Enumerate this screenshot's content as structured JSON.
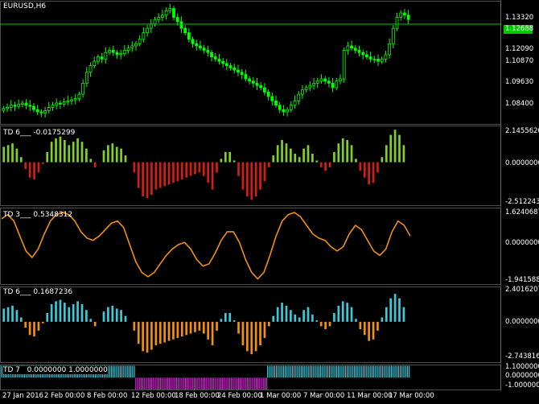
{
  "chart_title": "EURUSD,H6",
  "current_price": "1.12688",
  "colors": {
    "background": "#000000",
    "candle_up": "#00ff00",
    "candle_down": "#00ff00",
    "price_line": "#00c800",
    "td1_pos": "#7fd02a",
    "td1_neg": "#d11f14",
    "td2_line": "#f09010",
    "td3_pos": "#3cc8d8",
    "td3_neg": "#f09010",
    "td4_pos": "#3cc8d8",
    "td4_neg": "#e020e0",
    "separator": "#c0c0c0"
  },
  "main_pane": {
    "title": "EURUSD,H6",
    "y_ticks": [
      "1.13320",
      "1.12090",
      "1.10870",
      "1.09630",
      "1.08400"
    ]
  },
  "indicator_panes": [
    {
      "title": "TD 6___",
      "value": "-0.0175299",
      "y_ticks": [
        "2.1455620",
        "0.0000000",
        "-2.5122434"
      ]
    },
    {
      "title": "TD 3___",
      "value": "0.5348312",
      "y_ticks": [
        "1.6240687",
        "0.0000000",
        "-1.9415880"
      ]
    },
    {
      "title": "TD 6___",
      "value": "0.1687236",
      "y_ticks": [
        "2.4016207",
        "0.0000000",
        "-2.7438162"
      ]
    },
    {
      "title": "TD 7",
      "value": "0.0000000 1.0000000",
      "y_ticks": [
        "1.1000000",
        "0.0000000",
        "-1.0000000"
      ]
    }
  ],
  "x_ticks": [
    "27 Jan 2016",
    "2 Feb 00:00",
    "8 Feb 00:00",
    "12 Feb 00:00",
    "18 Feb 00:00",
    "24 Feb 00:00",
    "1 Mar 00:00",
    "7 Mar 00:00",
    "11 Mar 00:00",
    "17 Mar 00:00"
  ],
  "chart_data": [
    {
      "type": "candlestick",
      "title": "EURUSD,H6",
      "ylim": [
        1.0815,
        1.1375
      ],
      "close_series": [
        1.0885,
        1.089,
        1.09,
        1.0895,
        1.0905,
        1.091,
        1.09,
        1.0895,
        1.088,
        1.087,
        1.0865,
        1.0875,
        1.089,
        1.09,
        1.091,
        1.0905,
        1.0915,
        1.092,
        1.0925,
        1.093,
        1.095,
        1.1,
        1.105,
        1.108,
        1.11,
        1.112,
        1.111,
        1.114,
        1.115,
        1.114,
        1.113,
        1.1135,
        1.115,
        1.116,
        1.117,
        1.118,
        1.12,
        1.123,
        1.125,
        1.127,
        1.129,
        1.13,
        1.131,
        1.133,
        1.134,
        1.13,
        1.128,
        1.125,
        1.123,
        1.12,
        1.118,
        1.117,
        1.116,
        1.115,
        1.114,
        1.112,
        1.111,
        1.11,
        1.109,
        1.108,
        1.107,
        1.106,
        1.105,
        1.104,
        1.102,
        1.101,
        1.1,
        1.099,
        1.098,
        1.096,
        1.094,
        1.092,
        1.09,
        1.088,
        1.087,
        1.088,
        1.09,
        1.092,
        1.095,
        1.097,
        1.098,
        1.099,
        1.1,
        1.101,
        1.102,
        1.101,
        1.1,
        1.098,
        1.101,
        1.102,
        1.115,
        1.117,
        1.116,
        1.115,
        1.114,
        1.113,
        1.112,
        1.111,
        1.111,
        1.11,
        1.111,
        1.113,
        1.118,
        1.125,
        1.13,
        1.132,
        1.131,
        1.129
      ],
      "current_price": 1.12688
    },
    {
      "type": "histogram",
      "title": "TD 6___",
      "ylim": [
        -2.5122434,
        2.145562
      ],
      "values": [
        0.9,
        1.0,
        1.1,
        0.8,
        0.3,
        -0.4,
        -0.9,
        -1.0,
        -0.6,
        -0.1,
        0.6,
        1.2,
        1.4,
        1.5,
        1.3,
        1.0,
        1.2,
        1.4,
        1.2,
        0.8,
        0.2,
        -0.3,
        0.0,
        0.7,
        1.0,
        1.1,
        0.9,
        0.8,
        0.4,
        0.0,
        -0.6,
        -1.5,
        -2.0,
        -2.1,
        -1.9,
        -1.6,
        -1.5,
        -1.4,
        -1.3,
        -1.2,
        -1.1,
        -1.0,
        -0.9,
        -0.8,
        -0.7,
        -0.6,
        -0.8,
        -1.2,
        -1.6,
        -0.6,
        0.2,
        0.6,
        0.6,
        0.1,
        -0.8,
        -1.6,
        -2.0,
        -2.2,
        -2.0,
        -1.6,
        -1.1,
        -0.3,
        0.4,
        1.0,
        1.3,
        1.1,
        0.8,
        0.5,
        0.3,
        0.8,
        1.0,
        0.5,
        0.1,
        -0.3,
        -0.5,
        -0.3,
        0.6,
        1.1,
        1.4,
        1.3,
        1.0,
        0.2,
        -0.5,
        -0.9,
        -1.3,
        -1.2,
        -0.6,
        0.3,
        1.0,
        1.6,
        1.9,
        1.6,
        1.0,
        0.0
      ]
    },
    {
      "type": "line",
      "title": "TD 3___",
      "ylim": [
        -1.941588,
        1.6240687
      ],
      "values": [
        1.1,
        1.3,
        1.0,
        0.3,
        -0.4,
        -0.7,
        -0.3,
        0.4,
        1.0,
        1.3,
        1.4,
        1.3,
        1.0,
        0.5,
        0.2,
        0.1,
        0.3,
        0.6,
        0.9,
        1.0,
        0.7,
        -0.1,
        -0.9,
        -1.4,
        -1.6,
        -1.4,
        -1.0,
        -0.6,
        -0.3,
        -0.1,
        0.0,
        -0.3,
        -0.8,
        -1.1,
        -1.0,
        -0.5,
        0.1,
        0.5,
        0.5,
        0.0,
        -0.8,
        -1.4,
        -1.7,
        -1.4,
        -0.6,
        0.3,
        1.0,
        1.3,
        1.4,
        1.2,
        0.8,
        0.4,
        0.2,
        0.1,
        -0.2,
        -0.4,
        -0.2,
        0.4,
        0.8,
        0.6,
        0.1,
        -0.4,
        -0.6,
        -0.3,
        0.5,
        1.0,
        0.8,
        0.3
      ]
    },
    {
      "type": "histogram",
      "title": "TD 6___",
      "ylim": [
        -2.7438162,
        2.4016207
      ],
      "values": [
        0.9,
        1.0,
        1.1,
        0.8,
        0.3,
        -0.4,
        -0.9,
        -1.0,
        -0.6,
        -0.1,
        0.6,
        1.2,
        1.4,
        1.5,
        1.3,
        1.0,
        1.2,
        1.4,
        1.2,
        0.8,
        0.2,
        -0.3,
        0.0,
        0.7,
        1.0,
        1.1,
        0.9,
        0.8,
        0.4,
        0.0,
        -0.6,
        -1.5,
        -2.0,
        -2.1,
        -1.9,
        -1.6,
        -1.5,
        -1.4,
        -1.3,
        -1.2,
        -1.1,
        -1.0,
        -0.9,
        -0.8,
        -0.7,
        -0.6,
        -0.8,
        -1.2,
        -1.6,
        -0.6,
        0.2,
        0.6,
        0.6,
        0.1,
        -0.8,
        -1.6,
        -2.0,
        -2.2,
        -2.0,
        -1.6,
        -1.1,
        -0.3,
        0.4,
        1.0,
        1.3,
        1.1,
        0.8,
        0.5,
        0.3,
        0.8,
        1.0,
        0.5,
        0.1,
        -0.3,
        -0.5,
        -0.3,
        0.6,
        1.1,
        1.4,
        1.3,
        1.0,
        0.2,
        -0.5,
        -0.9,
        -1.3,
        -1.2,
        -0.6,
        0.3,
        1.0,
        1.6,
        1.9,
        1.6,
        1.0,
        0.0
      ]
    },
    {
      "type": "histogram",
      "title": "TD 7",
      "ylim": [
        -1.0,
        1.1
      ],
      "segments": [
        {
          "value": 1,
          "from": 0,
          "to": 0.3284
        },
        {
          "value": -1,
          "from": 0.3284,
          "to": 0.6508
        },
        {
          "value": 1,
          "from": 0.6508,
          "to": 1.0
        }
      ]
    }
  ]
}
